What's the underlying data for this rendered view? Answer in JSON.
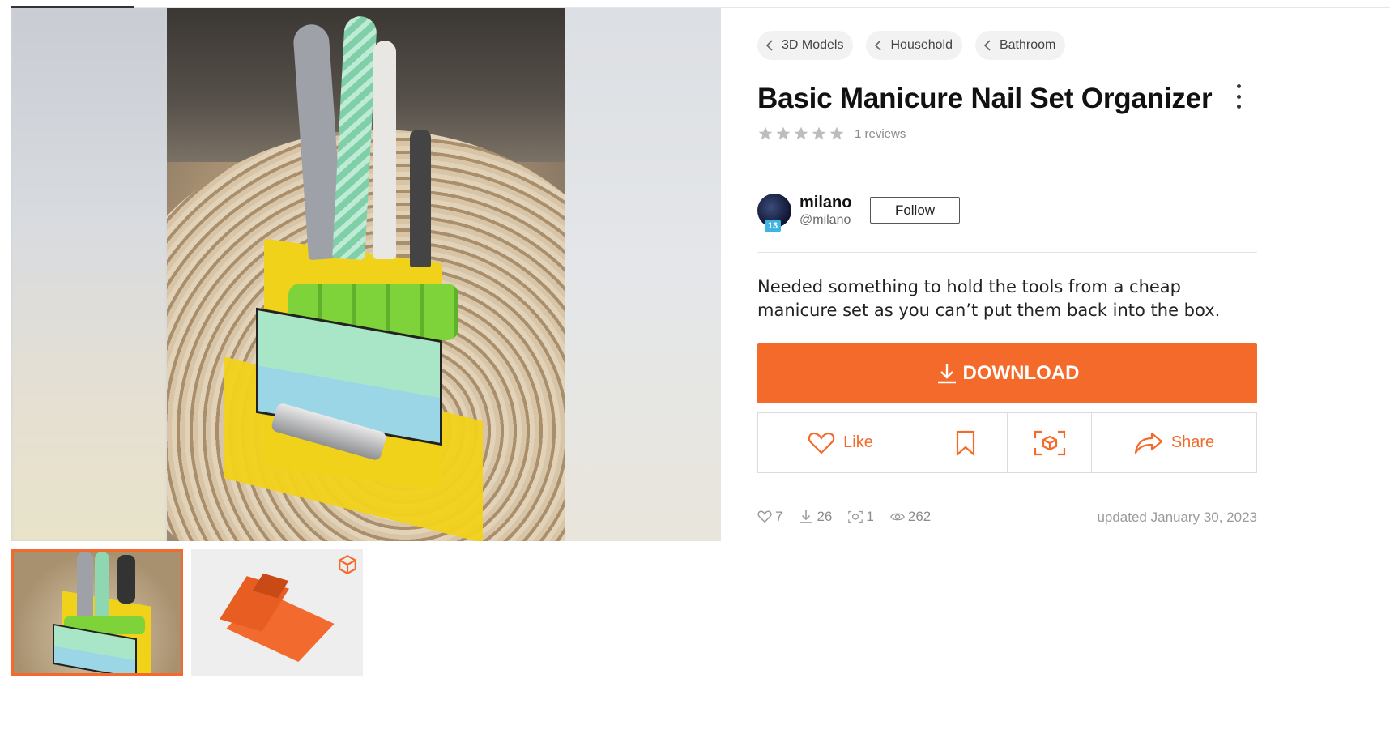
{
  "breadcrumbs": [
    {
      "label": "3D Models"
    },
    {
      "label": "Household"
    },
    {
      "label": "Bathroom"
    }
  ],
  "title": "Basic Manicure Nail Set Organizer",
  "rating": {
    "stars": 5,
    "filled": 0,
    "reviews_label": "1 reviews"
  },
  "author": {
    "name": "milano",
    "handle": "@milano",
    "level": "13"
  },
  "follow_label": "Follow",
  "description": "Needed something to hold the tools from a cheap manicure set as you can’t put them back into the box.",
  "download_label": "DOWNLOAD",
  "actions": {
    "like": "Like",
    "share": "Share"
  },
  "stats": {
    "likes": "7",
    "downloads": "26",
    "makes": "1",
    "views": "262"
  },
  "updated": "updated January 30, 2023",
  "colors": {
    "accent": "#f46a2b",
    "thumb_border": "#f26a2e",
    "star_empty": "#bdbdbd"
  },
  "icons": [
    "chevron-left-icon",
    "star-icon",
    "download-icon",
    "heart-icon",
    "bookmark-icon",
    "ar-view-icon",
    "share-icon",
    "eye-icon",
    "cube-icon",
    "more-vert-icon"
  ]
}
